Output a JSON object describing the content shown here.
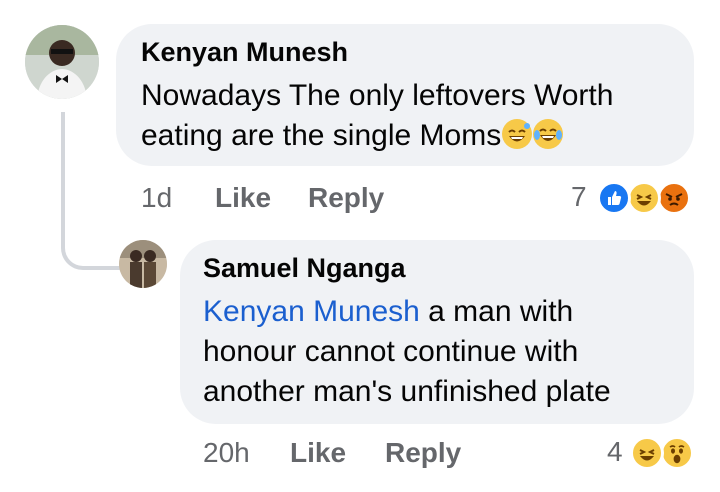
{
  "comment": {
    "author": "Kenyan Munesh",
    "text_line1": "Nowadays The only leftovers Worth",
    "text_line2": "eating are the single Moms",
    "time": "1d",
    "like_label": "Like",
    "reply_label": "Reply",
    "reaction_count": "7",
    "reactions": [
      "like-icon",
      "laugh-icon",
      "angry-icon"
    ]
  },
  "reply": {
    "author": "Samuel Nganga",
    "mention": "Kenyan Munesh",
    "text_line1": " a man with",
    "text_line2": "honour cannot continue with",
    "text_line3": "another man's unfinished plate",
    "time": "20h",
    "like_label": "Like",
    "reply_label": "Reply",
    "reaction_count": "4",
    "reactions": [
      "laugh-icon",
      "wow-icon"
    ]
  },
  "colors": {
    "bubble": "#f0f2f5",
    "mention": "#1b5fcf",
    "meta": "#65676b",
    "like_blue": "#1877f2",
    "angry_red": "#e9710f"
  }
}
